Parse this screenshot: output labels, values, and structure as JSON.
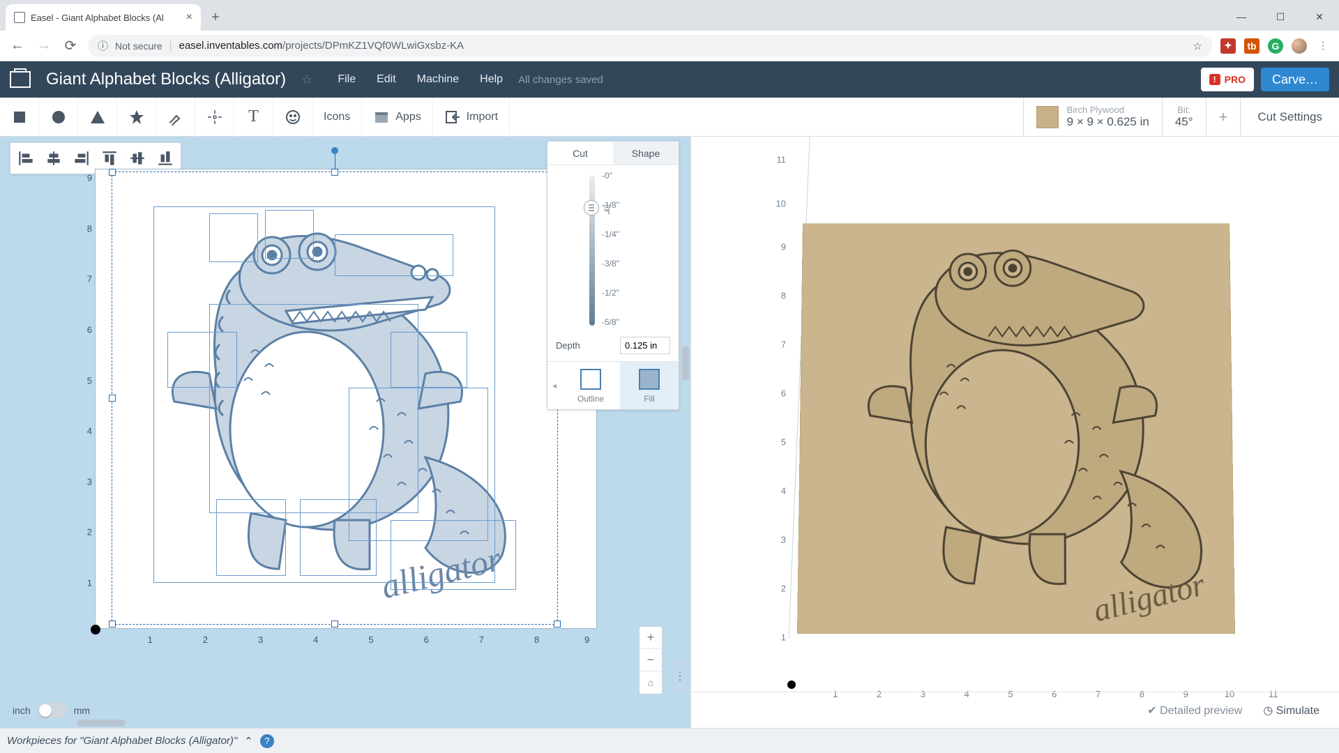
{
  "browser": {
    "tab_title": "Easel - Giant Alphabet Blocks (Al",
    "security": "Not secure",
    "url_host": "easel.inventables.com",
    "url_path": "/projects/DPmKZ1VQf0WLwiGxsbz-KA"
  },
  "header": {
    "project_title": "Giant Alphabet Blocks (Alligator)",
    "menu": {
      "file": "File",
      "edit": "Edit",
      "machine": "Machine",
      "help": "Help"
    },
    "save_status": "All changes saved",
    "pro_label": "PRO",
    "carve_label": "Carve…"
  },
  "toolbar": {
    "icons_label": "Icons",
    "apps_label": "Apps",
    "import_label": "Import",
    "material": {
      "name": "Birch Plywood",
      "dims": "9 × 9 × 0.625 in"
    },
    "bit": {
      "label": "Bit:",
      "value": "45°"
    },
    "cut_settings": "Cut Settings"
  },
  "prop_panel": {
    "tab_cut": "Cut",
    "tab_shape": "Shape",
    "ticks": [
      "0\"",
      "1/8\"",
      "1/4\"",
      "3/8\"",
      "1/2\"",
      "5/8\""
    ],
    "depth_label": "Depth",
    "depth_value": "0.125 in",
    "outline": "Outline",
    "fill": "Fill"
  },
  "canvas": {
    "y_ticks": [
      "9",
      "8",
      "7",
      "6",
      "5",
      "4",
      "3",
      "2",
      "1"
    ],
    "x_ticks": [
      "1",
      "2",
      "3",
      "4",
      "5",
      "6",
      "7",
      "8",
      "9",
      "1"
    ],
    "script_text": "alligator"
  },
  "preview": {
    "y_ticks": [
      "11",
      "10",
      "9",
      "8",
      "7",
      "6",
      "5",
      "4",
      "3",
      "2",
      "1"
    ],
    "x_ticks": [
      "1",
      "2",
      "3",
      "4",
      "5",
      "6",
      "7",
      "8",
      "9",
      "10",
      "11"
    ],
    "script_text": "alligator",
    "detailed": "Detailed preview",
    "simulate": "Simulate"
  },
  "units": {
    "inch": "inch",
    "mm": "mm"
  },
  "workpieces_bar": "Workpieces for \"Giant Alphabet Blocks (Alligator)\""
}
